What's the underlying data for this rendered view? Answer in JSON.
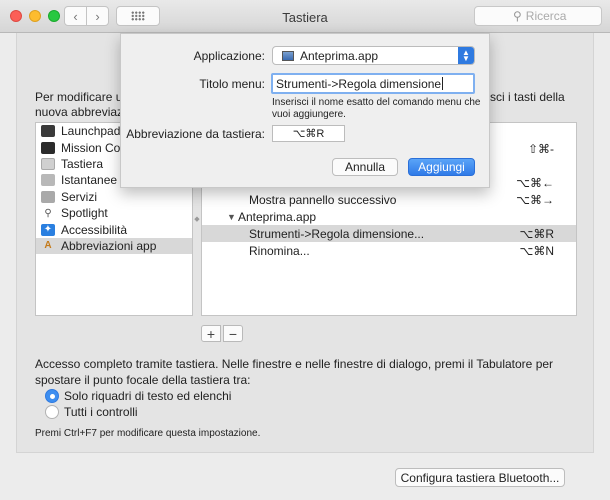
{
  "window": {
    "title": "Tastiera",
    "search_placeholder": "Ricerca"
  },
  "intro": {
    "text": "Per modificare un\nnuova abbreviazi",
    "right_text": "sci i tasti della"
  },
  "categories": [
    {
      "label": "Launchpad e"
    },
    {
      "label": "Mission Cont"
    },
    {
      "label": "Tastiera"
    },
    {
      "label": "Istantanee sc"
    },
    {
      "label": "Servizi"
    },
    {
      "label": "Spotlight"
    },
    {
      "label": "Accessibilità"
    },
    {
      "label": "Abbreviazioni app"
    }
  ],
  "shortcuts": [
    {
      "label": "",
      "key": "⇧⌘-"
    },
    {
      "label": "Mostra pannello successivo",
      "key": "⌥⌘←"
    },
    {
      "label": "Mostra pannello successivo",
      "key": "⌥⌘→"
    },
    {
      "label": "Anteprima.app",
      "key": ""
    },
    {
      "label": "Strumenti->Regola dimensione...",
      "key": "⌥⌘R"
    },
    {
      "label": "Rinomina...",
      "key": "⌥⌘N"
    }
  ],
  "buttons": {
    "plus": "+",
    "minus": "−",
    "bluetooth": "Configura tastiera Bluetooth..."
  },
  "access": {
    "text": "Accesso completo tramite tastiera. Nelle finestre e nelle finestre di dialogo, premi il Tabulatore per spostare il punto focale della tastiera tra:",
    "option1": "Solo riquadri di testo ed elenchi",
    "option2": "Tutti i controlli",
    "note": "Premi Ctrl+F7 per modificare questa impostazione."
  },
  "sheet": {
    "app_label": "Applicazione:",
    "app_value": "Anteprima.app",
    "menu_label": "Titolo menu:",
    "menu_value": "Strumenti->Regola dimensione",
    "help": "Inserisci il nome esatto del comando menu che vuoi aggiungere.",
    "shortcut_label": "Abbreviazione da tastiera:",
    "shortcut_value": "⌥⌘R",
    "cancel": "Annulla",
    "add": "Aggiungi"
  },
  "colors": {
    "accent": "#2f7ae0",
    "selection": "#d8d8d8"
  }
}
